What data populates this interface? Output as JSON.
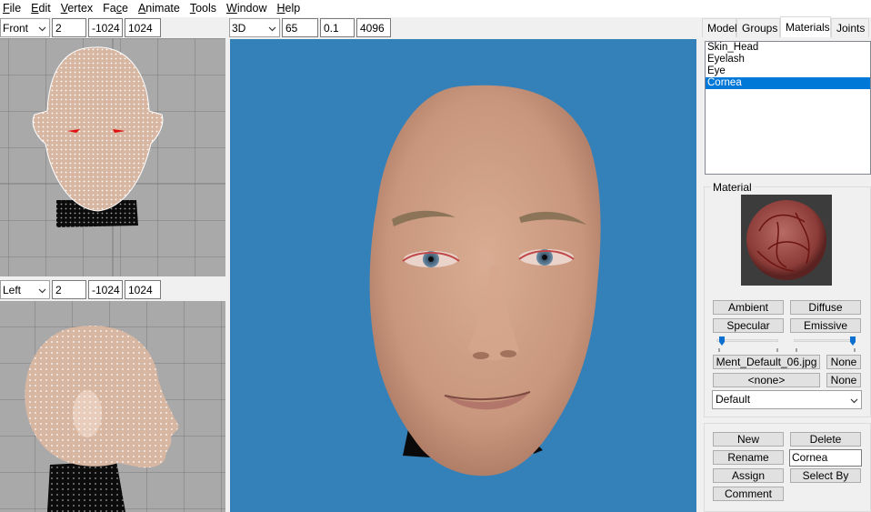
{
  "menu": [
    {
      "label": "File",
      "u": "F",
      "rest": "ile"
    },
    {
      "label": "Edit",
      "u": "E",
      "rest": "dit"
    },
    {
      "label": "Vertex",
      "u": "V",
      "rest": "ertex"
    },
    {
      "label": "Face",
      "pre": "Fa",
      "u": "c",
      "rest": "e"
    },
    {
      "label": "Animate",
      "u": "A",
      "rest": "nimate"
    },
    {
      "label": "Tools",
      "u": "T",
      "rest": "ools"
    },
    {
      "label": "Window",
      "u": "W",
      "rest": "indow"
    },
    {
      "label": "Help",
      "u": "H",
      "rest": "elp"
    }
  ],
  "front_view": {
    "view": "Front",
    "a": "2",
    "b": "-1024",
    "c": "1024"
  },
  "left_view": {
    "view": "Left",
    "a": "2",
    "b": "-1024",
    "c": "1024"
  },
  "main_view": {
    "view": "3D",
    "fov": "65",
    "near": "0.1",
    "far": "4096"
  },
  "tabs": [
    "Model",
    "Groups",
    "Materials",
    "Joints"
  ],
  "active_tab": "Materials",
  "materials": [
    "Skin_Head",
    "Eyelash",
    "Eye",
    "Cornea"
  ],
  "selected_material": "Cornea",
  "material_panel": {
    "title": "Material",
    "ambient": "Ambient",
    "diffuse": "Diffuse",
    "specular": "Specular",
    "emissive": "Emissive",
    "shininess_level": 0.05,
    "transparency_level": 1.0,
    "texture_file": "Ment_Default_06.jpg",
    "texture_none": "None",
    "alphamap": "<none>",
    "alphamap_none": "None",
    "shader": "Default"
  },
  "actions": {
    "new": "New",
    "delete": "Delete",
    "rename": "Rename",
    "name_value": "Cornea",
    "assign": "Assign",
    "select_by": "Select By",
    "comment": "Comment"
  },
  "colors": {
    "viewport_bg": "#3480b9",
    "grid_bg": "#a9a9a9",
    "selection": "#0078d7",
    "skin": "#d2a58c",
    "slider_thumb": "#0a6fd1"
  }
}
